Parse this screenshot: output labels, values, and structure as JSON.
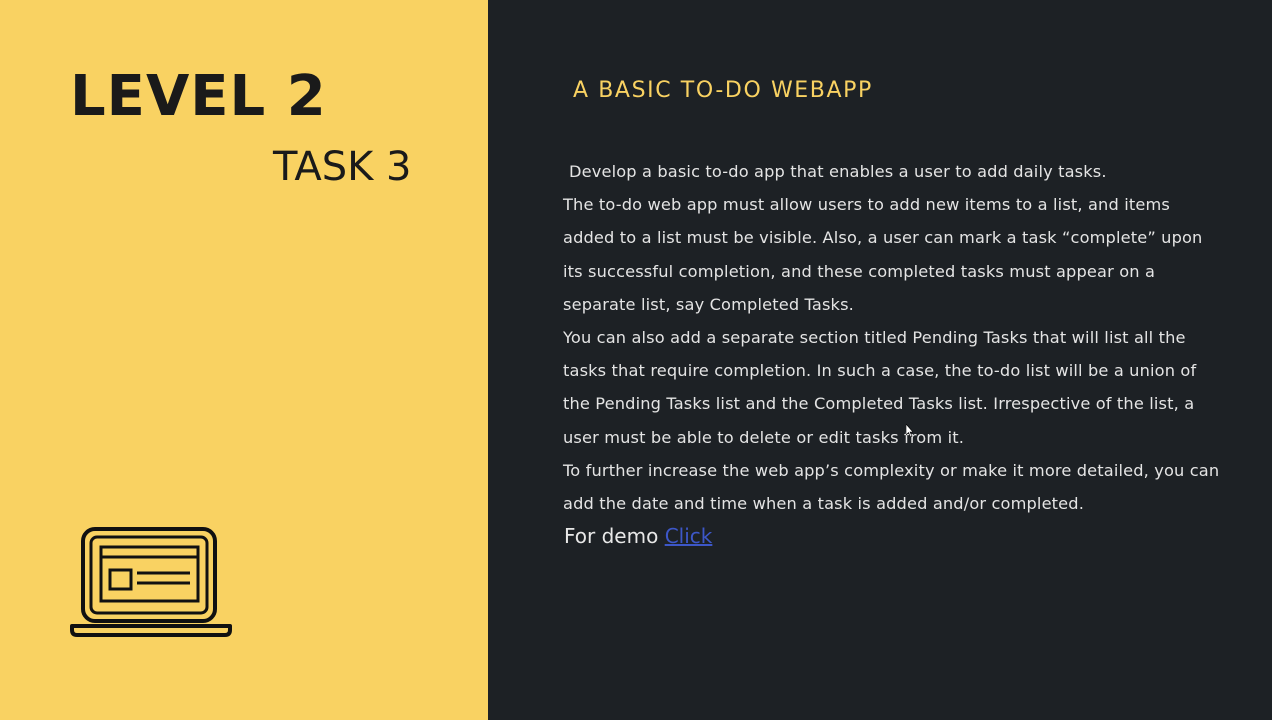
{
  "left_panel": {
    "level_title": "LEVEL 2",
    "task_title": "TASK 3",
    "icon": "laptop-browser-icon"
  },
  "right_panel": {
    "app_title": "A BASIC TO-DO WEBAPP",
    "paragraphs": [
      "Develop a basic to-do app that enables a user to add daily tasks.",
      "The to-do web app must allow users to add new items to a list, and items added to a list must be visible. Also, a user can mark a task “complete” upon its successful completion, and these completed tasks must appear on a separate list, say Completed Tasks.",
      "You can also add a separate section titled Pending Tasks that will list all the tasks that require completion. In such a case, the to-do list will be a union of the Pending Tasks list and the Completed Tasks list. Irrespective of the list, a user must be able to delete or edit tasks from it.",
      "To further increase the web app’s complexity or make it more detailed, you can add the date and time when a task is added and/or completed."
    ],
    "demo_label": "For demo",
    "demo_link": "Click"
  },
  "colors": {
    "accent_yellow": "#f9d262",
    "dark_background": "#1d2125",
    "link_blue": "#3d57c8"
  }
}
